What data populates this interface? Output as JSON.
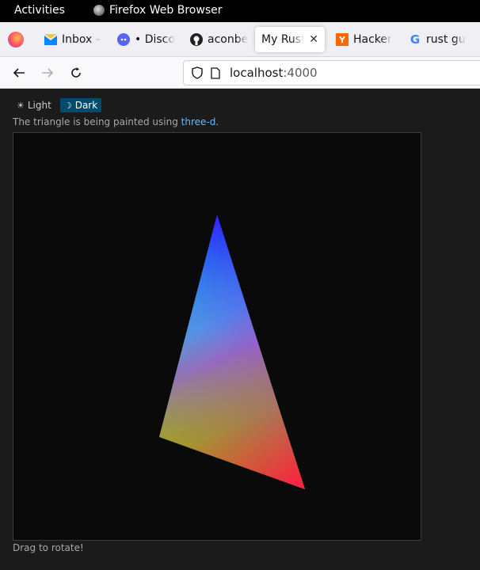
{
  "topbar": {
    "activities": "Activities",
    "app_name": "Firefox Web Browser"
  },
  "tabs": [
    {
      "label": "Inbox –",
      "icon": "mail-icon",
      "color": "#0a84ff"
    },
    {
      "label": "• Disco",
      "icon": "discord-icon",
      "color": "#5865f2"
    },
    {
      "label": "aconbe",
      "icon": "github-icon",
      "color": "#222222"
    },
    {
      "label": "My Rust",
      "icon": "none",
      "active": true
    },
    {
      "label": "Hacker",
      "icon": "hackernews-icon",
      "color": "#ff6600"
    },
    {
      "label": "rust gu",
      "icon": "google-icon",
      "color": "#4285f4"
    }
  ],
  "address": {
    "host": "localhost",
    "port": ":4000"
  },
  "theme": {
    "light_label": "Light",
    "dark_label": "Dark",
    "selected": "Dark"
  },
  "description": {
    "prefix": "The triangle is being painted using ",
    "link": "three-d",
    "suffix": "."
  },
  "hint": "Drag to rotate!",
  "triangle": {
    "vertex_colors": [
      "#3322ff",
      "#55ff22",
      "#ff1a44"
    ]
  }
}
